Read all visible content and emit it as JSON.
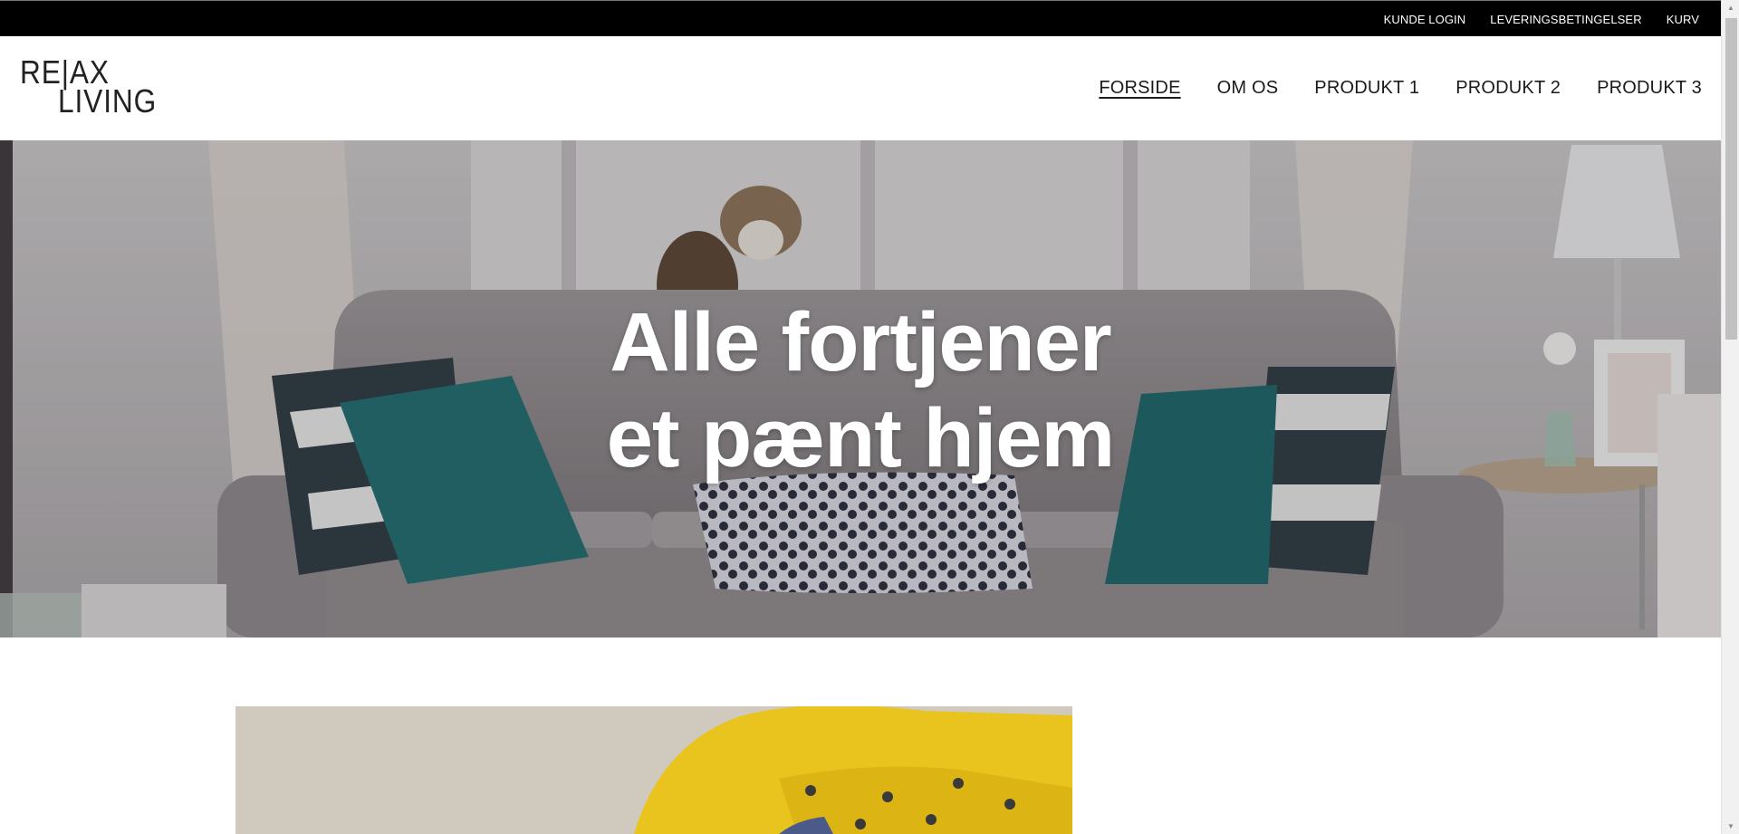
{
  "topbar": {
    "links": [
      "KUNDE LOGIN",
      "LEVERINGSBETINGELSER",
      "KURV"
    ]
  },
  "logo": {
    "line1": "RE|AX",
    "line2": "LIVING"
  },
  "nav": {
    "items": [
      {
        "label": "FORSIDE",
        "active": true
      },
      {
        "label": "OM OS",
        "active": false
      },
      {
        "label": "PRODUKT 1",
        "active": false
      },
      {
        "label": "PRODUKT 2",
        "active": false
      },
      {
        "label": "PRODUKT 3",
        "active": false
      }
    ]
  },
  "hero": {
    "title_line1": "Alle fortjener",
    "title_line2": "et pænt hjem"
  },
  "colors": {
    "topbar_bg": "#000000",
    "text_dark": "#1a1a1a",
    "hero_text": "#ffffff",
    "sofa": "#8e8a8c",
    "teal_pillow": "#1f6c70",
    "chair_yellow": "#e9c41f"
  }
}
